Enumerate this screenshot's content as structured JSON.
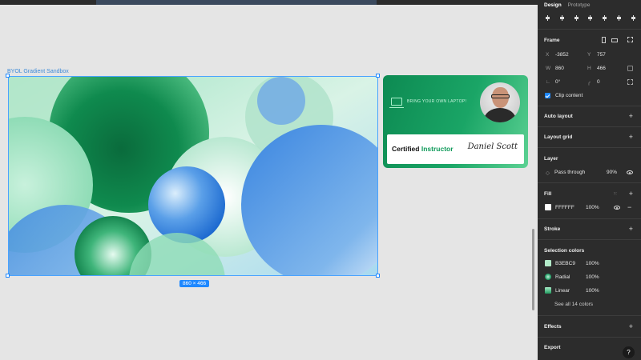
{
  "canvas": {
    "frame_name": "BYOL Gradient Sandbox",
    "size_badge": "860 × 466"
  },
  "card": {
    "tagline": "BRING YOUR OWN LAPTOP!",
    "certified": "Certified",
    "instructor": "Instructor",
    "signature": "Daniel Scott"
  },
  "panel": {
    "tabs": [
      "Design",
      "Prototype"
    ],
    "frame": {
      "title": "Frame",
      "x_label": "X",
      "x_value": "-3852",
      "y_label": "Y",
      "y_value": "757",
      "w_label": "W",
      "w_value": "860",
      "h_label": "H",
      "h_value": "466",
      "rotation": "0°",
      "radius": "0",
      "clip_label": "Clip content"
    },
    "auto_layout": "Auto layout",
    "layout_grid": "Layout grid",
    "layer": {
      "title": "Layer",
      "blend": "Pass through",
      "opacity": "90%"
    },
    "fill": {
      "title": "Fill",
      "hex": "FFFFFF",
      "opacity": "100%"
    },
    "stroke": "Stroke",
    "selection_colors": {
      "title": "Selection colors",
      "items": [
        {
          "name": "B3EBC9",
          "opacity": "100%",
          "color": "#b3ebc9"
        },
        {
          "name": "Radial",
          "opacity": "100%",
          "color": "#12955a"
        },
        {
          "name": "Linear",
          "opacity": "100%",
          "color": "#3fb27a"
        }
      ],
      "see_all": "See all 14 colors"
    },
    "effects": "Effects",
    "export": "Export",
    "help": "?"
  },
  "colors": {
    "accent": "#1e88ff",
    "panel_bg": "#2c2c2c",
    "canvas_bg": "#e5e5e5",
    "card_green": "#0f9a5a"
  },
  "icons": [
    "laptop-icon",
    "plus-icon",
    "minus-icon",
    "eye-icon",
    "checkbox-icon",
    "help-icon"
  ]
}
